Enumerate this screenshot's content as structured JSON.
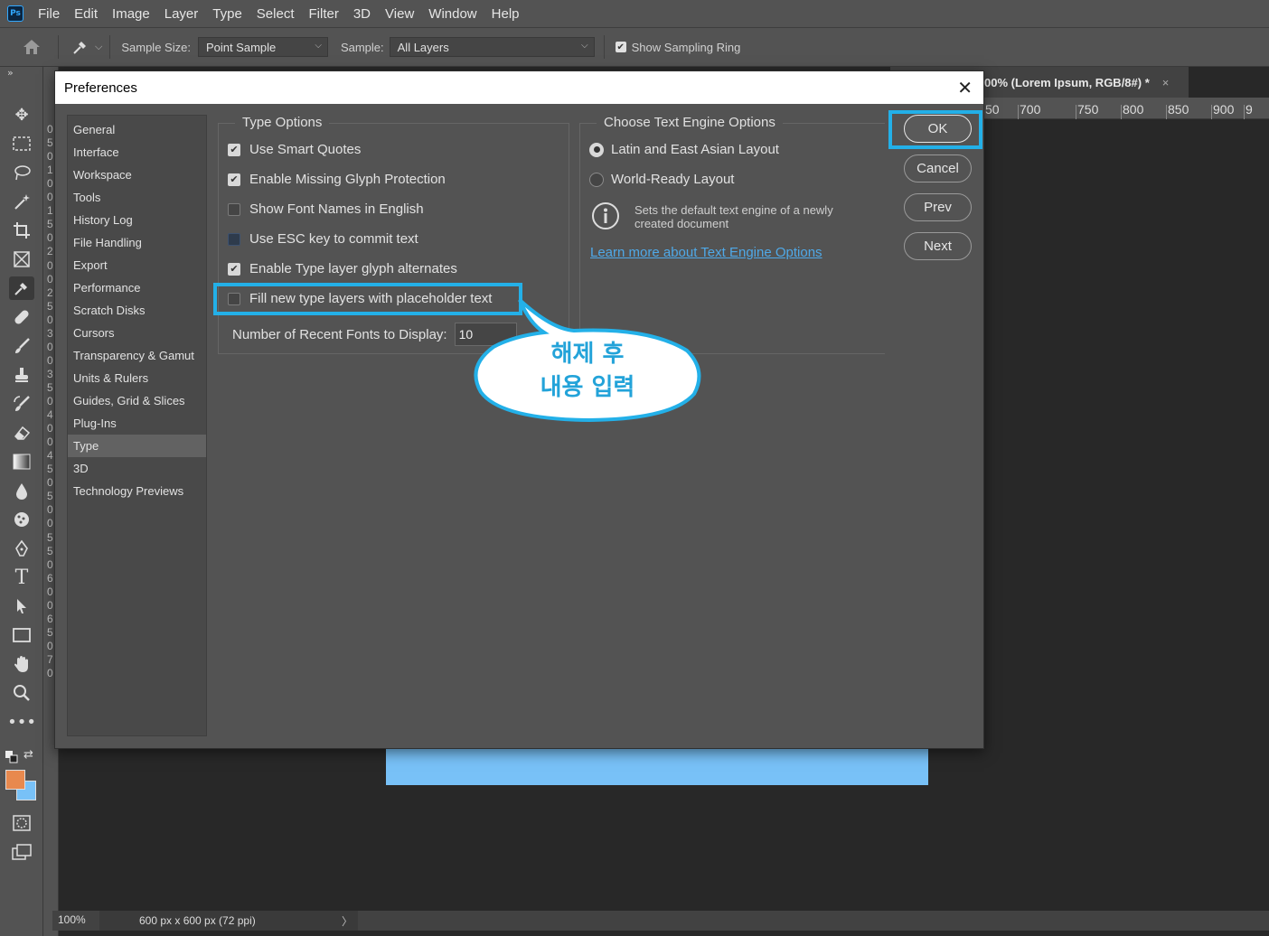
{
  "menubar": {
    "logo": "Ps",
    "items": [
      "File",
      "Edit",
      "Image",
      "Layer",
      "Type",
      "Select",
      "Filter",
      "3D",
      "View",
      "Window",
      "Help"
    ]
  },
  "optionsbar": {
    "sample_size_label": "Sample Size:",
    "sample_size_value": "Point Sample",
    "sample_label": "Sample:",
    "sample_value": "All Layers",
    "show_ring_label": "Show Sampling Ring",
    "show_ring_checked": true
  },
  "doc_tab": {
    "title": "00% (Lorem Ipsum, RGB/8#) *",
    "close": "×"
  },
  "hruler": [
    "50",
    "700",
    "750",
    "800",
    "850",
    "900",
    "9"
  ],
  "vruler": [
    "0",
    "5",
    "0",
    "1",
    "0",
    "0",
    "1",
    "5",
    "0",
    "2",
    "0",
    "0",
    "2",
    "5",
    "0",
    "3",
    "0",
    "0",
    "3",
    "5",
    "0",
    "4",
    "0",
    "0",
    "4",
    "5",
    "0",
    "5",
    "0",
    "0",
    "5",
    "5",
    "0",
    "6",
    "0",
    "0",
    "6",
    "5",
    "0",
    "7",
    "0"
  ],
  "statusbar": {
    "zoom": "100%",
    "docinfo": "600 px x 600 px (72 ppi)",
    "arrow": "〉"
  },
  "dialog": {
    "title": "Preferences",
    "close": "✕",
    "categories": [
      "General",
      "Interface",
      "Workspace",
      "Tools",
      "History Log",
      "File Handling",
      "Export",
      "Performance",
      "Scratch Disks",
      "Cursors",
      "Transparency & Gamut",
      "Units & Rulers",
      "Guides, Grid & Slices",
      "Plug-Ins",
      "Type",
      "3D",
      "Technology Previews"
    ],
    "selected_category": "Type",
    "type_options": {
      "legend": "Type Options",
      "items": [
        {
          "label": "Use Smart Quotes",
          "checked": true
        },
        {
          "label": "Enable Missing Glyph Protection",
          "checked": true
        },
        {
          "label": "Show Font Names in English",
          "checked": false
        },
        {
          "label": "Use ESC key to commit text",
          "checked": false
        },
        {
          "label": "Enable Type layer glyph alternates",
          "checked": true
        },
        {
          "label": "Fill new type layers with placeholder text",
          "checked": false
        }
      ],
      "recent_fonts_label": "Number of Recent Fonts to Display:",
      "recent_fonts_value": "10"
    },
    "engine_options": {
      "legend": "Choose Text Engine Options",
      "radios": [
        {
          "label": "Latin and East Asian Layout",
          "selected": true
        },
        {
          "label": "World-Ready Layout",
          "selected": false
        }
      ],
      "info_text": "Sets the default text engine of a newly created document",
      "learn_more": "Learn more about Text Engine Options"
    },
    "buttons": {
      "ok": "OK",
      "cancel": "Cancel",
      "prev": "Prev",
      "next": "Next"
    }
  },
  "callout": {
    "line1": "해제 후",
    "line2": "내용 입력"
  },
  "colors": {
    "highlight": "#23b0e8",
    "foreground_swatch": "#e8894e",
    "background_swatch": "#78c1f7",
    "canvas": "#78c1f7"
  }
}
